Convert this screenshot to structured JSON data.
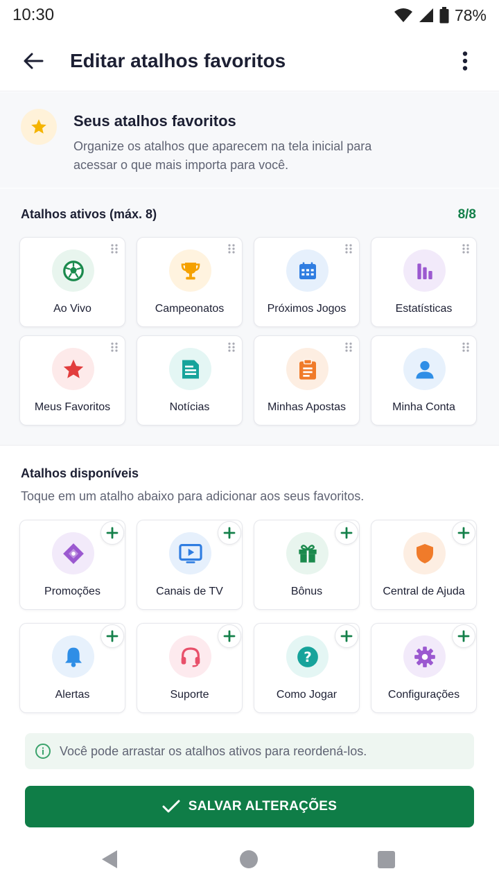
{
  "status": {
    "time": "10:30",
    "battery": "78%"
  },
  "appbar": {
    "title": "Editar atalhos favoritos"
  },
  "intro": {
    "title": "Seus atalhos favoritos",
    "description": "Organize os atalhos que aparecem na tela inicial para acessar o que mais importa para você."
  },
  "active": {
    "heading": "Atalhos ativos (máx. 8)",
    "count": "8/8",
    "items": [
      {
        "label": "Ao Vivo",
        "icon": "soccer-ball-icon",
        "color": "#1b8a4d",
        "bg": "#e8f5ee"
      },
      {
        "label": "Campeonatos",
        "icon": "trophy-icon",
        "color": "#f5a100",
        "bg": "#fff3df"
      },
      {
        "label": "Próximos Jogos",
        "icon": "calendar-icon",
        "color": "#2f7de1",
        "bg": "#e6f0fc"
      },
      {
        "label": "Estatísticas",
        "icon": "bar-chart-icon",
        "color": "#9b59d0",
        "bg": "#f2eafa"
      },
      {
        "label": "Meus Favoritos",
        "icon": "star-icon",
        "color": "#e23d3d",
        "bg": "#fdeaea"
      },
      {
        "label": "Notícias",
        "icon": "news-icon",
        "color": "#17a39b",
        "bg": "#e4f6f4"
      },
      {
        "label": "Minhas Apostas",
        "icon": "clipboard-icon",
        "color": "#f07b2a",
        "bg": "#fdeee2"
      },
      {
        "label": "Minha Conta",
        "icon": "user-icon",
        "color": "#2f8ee6",
        "bg": "#e7f1fc"
      }
    ]
  },
  "available": {
    "heading": "Atalhos disponíveis",
    "subtitle": "Toque em um atalho abaixo para adicionar aos seus favoritos.",
    "items": [
      {
        "label": "Promoções",
        "icon": "tag-icon",
        "color": "#9b59d0",
        "bg": "#f2eafa"
      },
      {
        "label": "Canais de TV",
        "icon": "tv-play-icon",
        "color": "#2f7de1",
        "bg": "#e6f0fc"
      },
      {
        "label": "Bônus",
        "icon": "gift-icon",
        "color": "#1b8a4d",
        "bg": "#e8f5ee"
      },
      {
        "label": "Central de Ajuda",
        "icon": "shield-icon",
        "color": "#f07b2a",
        "bg": "#fdeee2"
      },
      {
        "label": "Alertas",
        "icon": "bell-icon",
        "color": "#2f8ee6",
        "bg": "#e7f1fc"
      },
      {
        "label": "Suporte",
        "icon": "headset-icon",
        "color": "#e8506a",
        "bg": "#fdeaee"
      },
      {
        "label": "Como Jogar",
        "icon": "question-icon",
        "color": "#17a39b",
        "bg": "#e4f6f4"
      },
      {
        "label": "Configurações",
        "icon": "gear-icon",
        "color": "#9b59d0",
        "bg": "#f2eafa"
      }
    ]
  },
  "tip": {
    "text": "Você pode arrastar os atalhos ativos para reordená-los."
  },
  "save": {
    "label": "SALVAR ALTERAÇÕES"
  },
  "colors": {
    "primary": "#0f7d47",
    "accent_count": "#14804a"
  }
}
